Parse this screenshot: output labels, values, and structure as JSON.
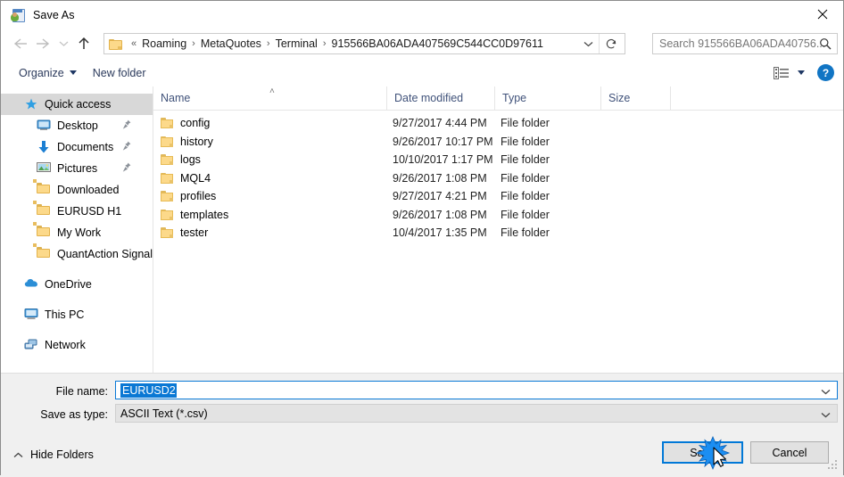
{
  "window": {
    "title": "Save As",
    "icon": "save-as-icon",
    "close_label": "✕"
  },
  "nav": {
    "back": "←",
    "forward": "→",
    "recent": "⌄",
    "up": "↑"
  },
  "address": {
    "leading": "«",
    "crumbs": [
      "Roaming",
      "MetaQuotes",
      "Terminal",
      "915566BA06ADA407569C544CC0D97611"
    ],
    "separator": "›",
    "dropdown": "⌄",
    "refresh": "↻"
  },
  "search": {
    "placeholder": "Search 915566BA06ADA40756...",
    "icon": "search-icon"
  },
  "toolbar": {
    "organize": "Organize",
    "new_folder": "New folder",
    "view_icon": "view-layout-icon",
    "view_caret": "▾",
    "help": "?"
  },
  "sidebar": {
    "items": [
      {
        "label": "Quick access",
        "icon": "star-icon",
        "selected": true,
        "pinned": false,
        "indent": 0
      },
      {
        "label": "Desktop",
        "icon": "desktop-icon",
        "selected": false,
        "pinned": true,
        "indent": 1
      },
      {
        "label": "Documents",
        "icon": "documents-icon",
        "selected": false,
        "pinned": true,
        "indent": 1
      },
      {
        "label": "Pictures",
        "icon": "pictures-icon",
        "selected": false,
        "pinned": true,
        "indent": 1
      },
      {
        "label": "Downloaded",
        "icon": "folder-icon",
        "selected": false,
        "pinned": false,
        "indent": 1
      },
      {
        "label": "EURUSD H1",
        "icon": "folder-icon",
        "selected": false,
        "pinned": false,
        "indent": 1
      },
      {
        "label": "My Work",
        "icon": "folder-icon",
        "selected": false,
        "pinned": false,
        "indent": 1
      },
      {
        "label": "QuantAction Signal",
        "icon": "folder-icon",
        "selected": false,
        "pinned": false,
        "indent": 1
      },
      {
        "label": "OneDrive",
        "icon": "onedrive-icon",
        "selected": false,
        "pinned": false,
        "indent": 0,
        "gap": true
      },
      {
        "label": "This PC",
        "icon": "thispc-icon",
        "selected": false,
        "pinned": false,
        "indent": 0,
        "gap": true
      },
      {
        "label": "Network",
        "icon": "network-icon",
        "selected": false,
        "pinned": false,
        "indent": 0,
        "gap": true
      }
    ]
  },
  "filelist": {
    "columns": [
      "Name",
      "Date modified",
      "Type",
      "Size"
    ],
    "sort_column": "Name",
    "sort_caret": "˄",
    "rows": [
      {
        "name": "config",
        "date": "9/27/2017 4:44 PM",
        "type": "File folder",
        "size": ""
      },
      {
        "name": "history",
        "date": "9/26/2017 10:17 PM",
        "type": "File folder",
        "size": ""
      },
      {
        "name": "logs",
        "date": "10/10/2017 1:17 PM",
        "type": "File folder",
        "size": ""
      },
      {
        "name": "MQL4",
        "date": "9/26/2017 1:08 PM",
        "type": "File folder",
        "size": ""
      },
      {
        "name": "profiles",
        "date": "9/27/2017 4:21 PM",
        "type": "File folder",
        "size": ""
      },
      {
        "name": "templates",
        "date": "9/26/2017 1:08 PM",
        "type": "File folder",
        "size": ""
      },
      {
        "name": "tester",
        "date": "10/4/2017 1:35 PM",
        "type": "File folder",
        "size": ""
      }
    ]
  },
  "form": {
    "filename_label": "File name:",
    "filename_value": "EURUSD2",
    "filetype_label": "Save as type:",
    "filetype_value": "ASCII Text (*.csv)",
    "chevron": "⌄"
  },
  "footer": {
    "hide_folders": "Hide Folders",
    "hide_caret": "˄",
    "save": "Save",
    "cancel": "Cancel"
  },
  "colors": {
    "accent": "#0078d7",
    "selection": "#0a78d4",
    "folder": "#fcd98a",
    "help_blue": "#1175c4",
    "header_text": "#40527a"
  }
}
